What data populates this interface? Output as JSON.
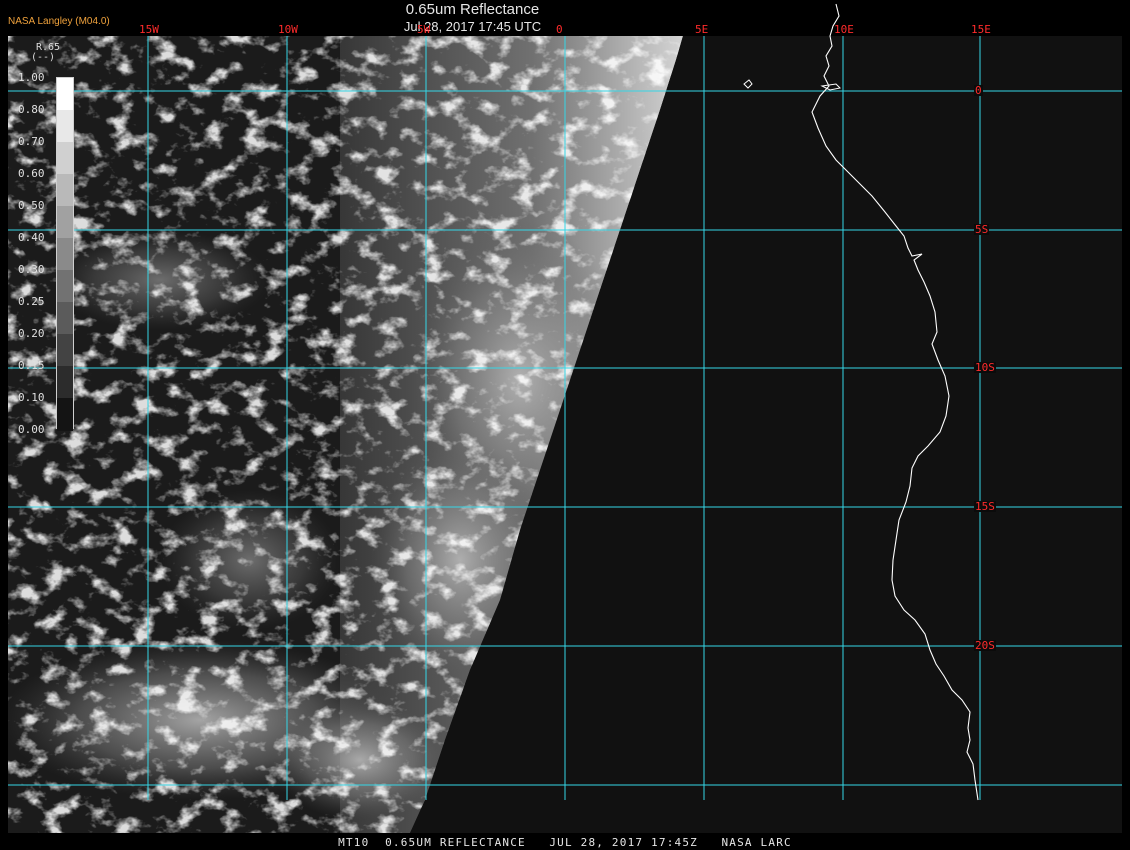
{
  "title": "0.65um Reflectance",
  "timestamp": "Jul 28, 2017 17:45 UTC",
  "organization": "NASA Langley (M04.0)",
  "legend": {
    "title": "R.65",
    "units": "(--)",
    "ticks": [
      "1.00",
      "0.80",
      "0.70",
      "0.60",
      "0.50",
      "0.40",
      "0.30",
      "0.25",
      "0.20",
      "0.15",
      "0.10",
      "0.00"
    ]
  },
  "grid": {
    "longitudes": [
      "15W",
      "10W",
      "5W",
      "0",
      "5E",
      "10E",
      "15E"
    ],
    "latitudes": [
      "0",
      "5S",
      "10S",
      "15S",
      "20S"
    ]
  },
  "footer": "MT10  0.65UM REFLECTANCE   JUL 28, 2017 17:45Z   NASA LARC",
  "colors": {
    "grid": "#35d6e6",
    "grid_labels": "#ff2b2b",
    "coastline": "#ffffff",
    "org_label": "#f0a23c"
  }
}
